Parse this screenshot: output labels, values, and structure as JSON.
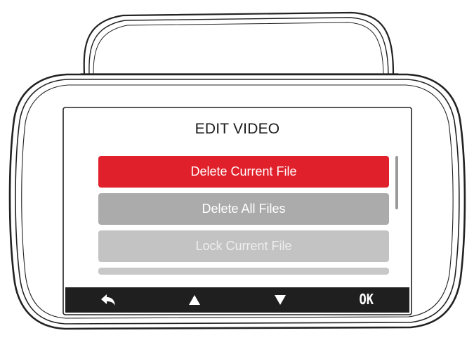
{
  "screen": {
    "title": "EDIT VIDEO"
  },
  "menu": {
    "items": [
      {
        "label": "Delete Current File",
        "state": "selected"
      },
      {
        "label": "Delete All Files",
        "state": "normal"
      },
      {
        "label": "Lock Current File",
        "state": "faded"
      }
    ],
    "selected_color": "#e0202a",
    "item_color": "#ababab"
  },
  "softkeys": [
    {
      "icon": "back-arrow-icon"
    },
    {
      "icon": "up-arrow-icon"
    },
    {
      "icon": "down-arrow-icon"
    },
    {
      "label": "OK"
    }
  ]
}
